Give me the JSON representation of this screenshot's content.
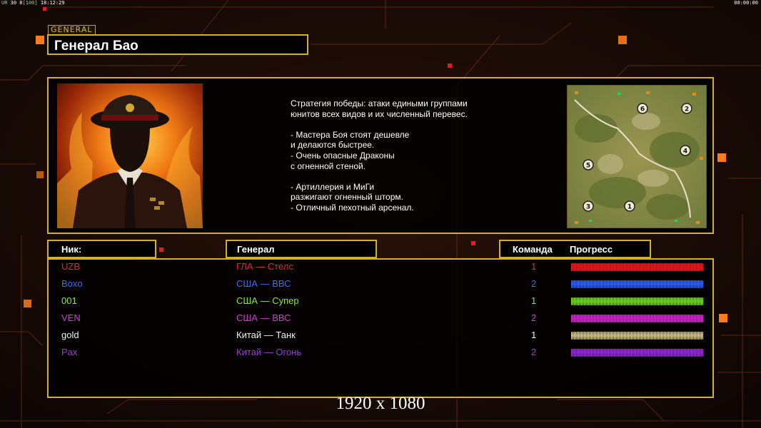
{
  "hud": {
    "fps_prefix": "UR",
    "fps_value": "30 8",
    "fps_bracket": "[100]",
    "clock": "18:12:29",
    "timer": "00:00:00"
  },
  "general": {
    "tag": "GENERAL",
    "name": "Генерал Бао"
  },
  "description": [
    "Стратегия победы: атаки едиными группами",
    "юнитов всех видов и их численный перевес.",
    "",
    "- Мастера Боя стоят дешевле",
    "и делаются быстрее.",
    "- Очень опасные Драконы",
    "с огненной стеной.",
    "",
    "- Артиллерия и МиГи",
    "разжигают огненный шторм.",
    "- Отличный пехотный арсенал."
  ],
  "map": {
    "start_positions": [
      "6",
      "2",
      "4",
      "5",
      "3",
      "1"
    ]
  },
  "headers": {
    "nick": "Ник:",
    "general": "Генерал",
    "team": "Команда",
    "progress": "Прогресс"
  },
  "players": [
    {
      "nick": "UZB",
      "general": "ГЛА — Стелс",
      "team": "1",
      "color": "#e8242a",
      "progress": 1.0
    },
    {
      "nick": "Boxo",
      "general": "США — ВВС",
      "team": "2",
      "color": "#3f6cf0",
      "progress": 1.0
    },
    {
      "nick": "001",
      "general": "США — Супер",
      "team": "1",
      "color": "#8ce83a",
      "progress": 1.0
    },
    {
      "nick": "VEN",
      "general": "США — ВВС",
      "team": "2",
      "color": "#d03ad0",
      "progress": 1.0
    },
    {
      "nick": "gold",
      "general": "Китай — Танк",
      "team": "1",
      "color": "#f2f2f2",
      "bar_color": "#e8dcb0",
      "progress": 1.0
    },
    {
      "nick": "Pax",
      "general": "Китай — Огонь",
      "team": "2",
      "color": "#9a3ad8",
      "progress": 1.0
    }
  ],
  "resolution_label": "1920 x 1080"
}
